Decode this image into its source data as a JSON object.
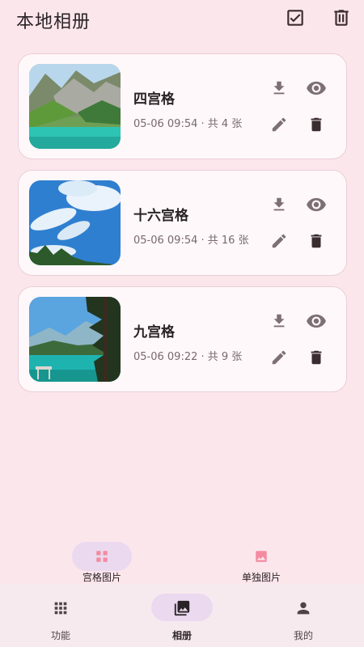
{
  "header": {
    "title": "本地相册",
    "icons": {
      "select_all": "check-box-icon",
      "delete_all": "trash-icon"
    }
  },
  "albums": [
    {
      "name": "四宫格",
      "meta": "05-06 09:54 · 共 4 张",
      "thumb": "mountain-lake-thumbnail"
    },
    {
      "name": "十六宫格",
      "meta": "05-06 09:54 · 共 16 张",
      "thumb": "blue-sky-clouds-thumbnail"
    },
    {
      "name": "九宫格",
      "meta": "05-06 09:22 · 共 9 张",
      "thumb": "pine-lake-thumbnail"
    }
  ],
  "actions": {
    "download": "download-icon",
    "view": "eye-icon",
    "edit": "pencil-icon",
    "delete": "trash-icon"
  },
  "subtabs": {
    "grid": "宫格图片",
    "single": "单独图片",
    "active": "grid"
  },
  "bottom_nav": {
    "function": "功能",
    "album": "相册",
    "mine": "我的",
    "active": "album"
  },
  "colors": {
    "background": "#fbe6ec",
    "card": "#fff8fa",
    "active_pill": "#ead9ef",
    "accent_pink": "#f48aa0",
    "icon_dark": "#3b2c30",
    "icon_muted": "#7d7074"
  }
}
